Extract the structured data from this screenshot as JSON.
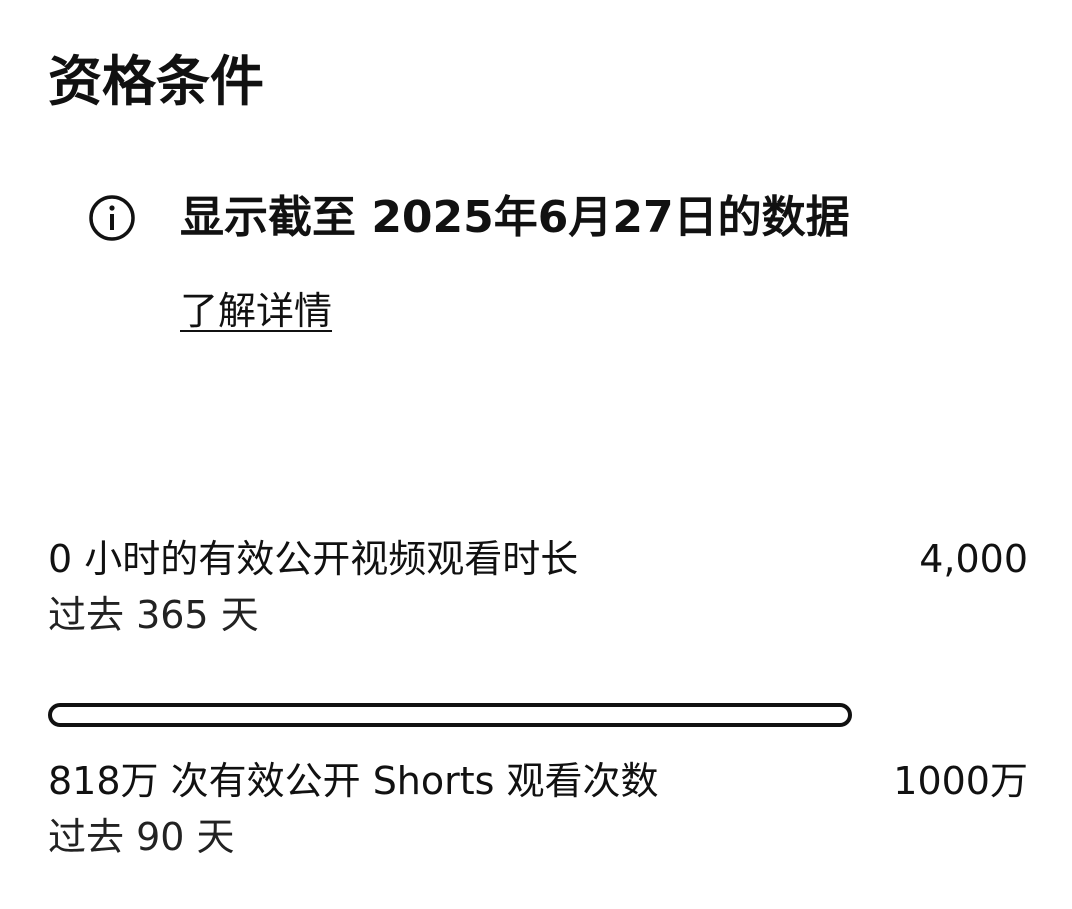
{
  "header": {
    "title": "资格条件"
  },
  "notice": {
    "icon": "info-icon",
    "text": "显示截至 2025年6月27日的数据",
    "link_label": "了解详情"
  },
  "metrics": [
    {
      "label": "0 小时的有效公开视频观看时长",
      "target": "4,000",
      "period": "过去 365 天",
      "progress": 0
    },
    {
      "label": "818万 次有效公开 Shorts 观看次数",
      "target": "1000万",
      "period": "过去 90 天"
    }
  ]
}
